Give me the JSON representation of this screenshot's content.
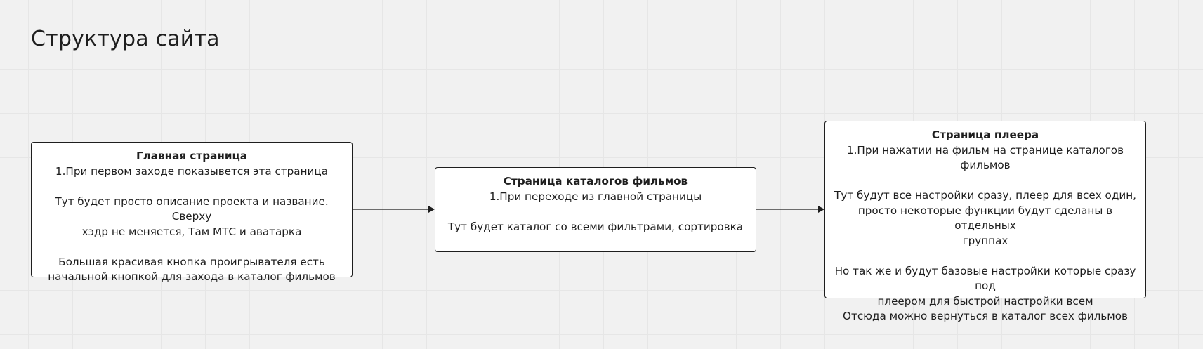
{
  "board": {
    "title": "Структура сайта"
  },
  "nodes": {
    "home": {
      "heading": "Главная страница",
      "lines": [
        "1.При первом заходе показывется эта страница",
        "",
        "Тут будет просто описание проекта и название. Сверху",
        "хэдр не меняется, Там МТС и аватарка",
        "",
        "Большая красивая кнопка проигрывателя есть",
        "начальной кнопкой для захода в каталог фильмов"
      ]
    },
    "catalog": {
      "heading": "Страница каталогов фильмов",
      "lines": [
        "1.При переходе из главной страницы",
        "",
        "Тут будет каталог со всеми фильтрами, сортировка"
      ]
    },
    "player": {
      "heading": "Страница плеера",
      "lines": [
        "1.При нажатии на фильм на странице каталогов",
        "фильмов",
        "",
        "Тут будут все настройки сразу, плеер для всех один,",
        "просто некоторые функции будут сделаны в отдельных",
        "группах",
        "",
        "Но так же и будут базовые настройки которые сразу под",
        "плеером для быстрой настройки всем",
        "Отсюда можно вернуться в каталог всех фильмов"
      ]
    }
  },
  "colors": {
    "background": "#f1f1f1",
    "grid": "#e6e6e6",
    "node_fill": "#ffffff",
    "stroke": "#1e1e1e"
  }
}
